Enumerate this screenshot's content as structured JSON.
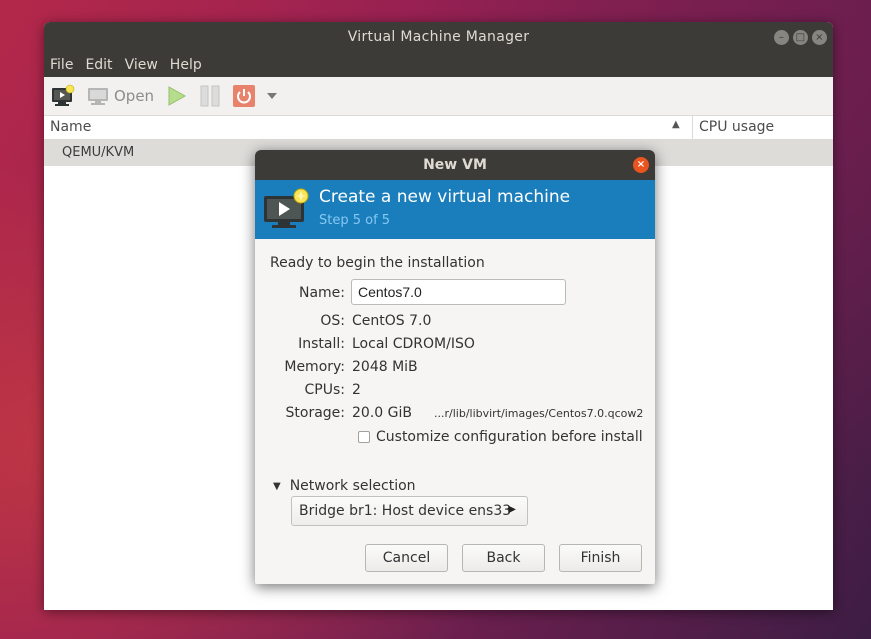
{
  "main_window": {
    "title": "Virtual Machine Manager",
    "window_controls": {
      "minimize": "–",
      "maximize": "□",
      "close": "×"
    },
    "menu": [
      "File",
      "Edit",
      "View",
      "Help"
    ],
    "toolbar": {
      "open_label": "Open",
      "icons": [
        "new-vm-icon",
        "monitor-icon",
        "play-icon",
        "pause-icon",
        "power-icon",
        "dropdown-arrow-icon"
      ]
    },
    "columns": {
      "name": "Name",
      "cpu": "CPU usage",
      "sort_glyph": "▲"
    },
    "connection": "QEMU/KVM"
  },
  "dialog": {
    "title": "New VM",
    "close_glyph": "×",
    "header": {
      "title": "Create a new virtual machine",
      "step": "Step 5 of 5"
    },
    "ready_text": "Ready to begin the installation",
    "fields": {
      "name_label": "Name:",
      "name_value": "Centos7.0",
      "os_label": "OS:",
      "os_value": "CentOS 7.0",
      "install_label": "Install:",
      "install_value": "Local CDROM/ISO",
      "memory_label": "Memory:",
      "memory_value": "2048 MiB",
      "cpus_label": "CPUs:",
      "cpus_value": "2",
      "storage_label": "Storage:",
      "storage_size": "20.0 GiB",
      "storage_path": "...r/lib/libvirt/images/Centos7.0.qcow2"
    },
    "customize": {
      "label": "Customize configuration before install",
      "checked": false
    },
    "network": {
      "expander_glyph": "▼",
      "section_label": "Network selection",
      "selected": "Bridge br1: Host device ens33",
      "arrow_glyph": "▶"
    },
    "buttons": {
      "cancel": "Cancel",
      "back": "Back",
      "finish": "Finish"
    }
  },
  "colors": {
    "titlebar": "#3c3b37",
    "banner": "#1a7dbc",
    "close_accent": "#e95420",
    "step_text": "#86c9f2"
  }
}
